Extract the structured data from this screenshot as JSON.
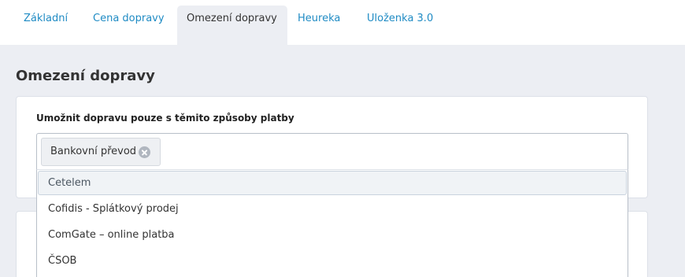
{
  "tabs": [
    {
      "label": "Základní"
    },
    {
      "label": "Cena dopravy"
    },
    {
      "label": "Omezení dopravy",
      "active": true
    },
    {
      "label": "Heureka"
    },
    {
      "label": "Uloženka 3.0"
    }
  ],
  "page": {
    "title": "Omezení dopravy"
  },
  "payment_restriction": {
    "label": "Umožnit dopravu pouze s těmito způsoby platby",
    "selected": [
      {
        "label": "Bankovní převod"
      }
    ],
    "options": [
      {
        "label": "Cetelem",
        "highlighted": true
      },
      {
        "label": "Cofidis - Splátkový prodej"
      },
      {
        "label": "ComGate – online platba"
      },
      {
        "label": "ČSOB"
      }
    ]
  },
  "colors": {
    "accent": "#1f8bc4",
    "page_background": "#eceef3",
    "chip_background": "#eef0f3"
  },
  "icons": {
    "chip_remove": "close-circle-icon"
  }
}
